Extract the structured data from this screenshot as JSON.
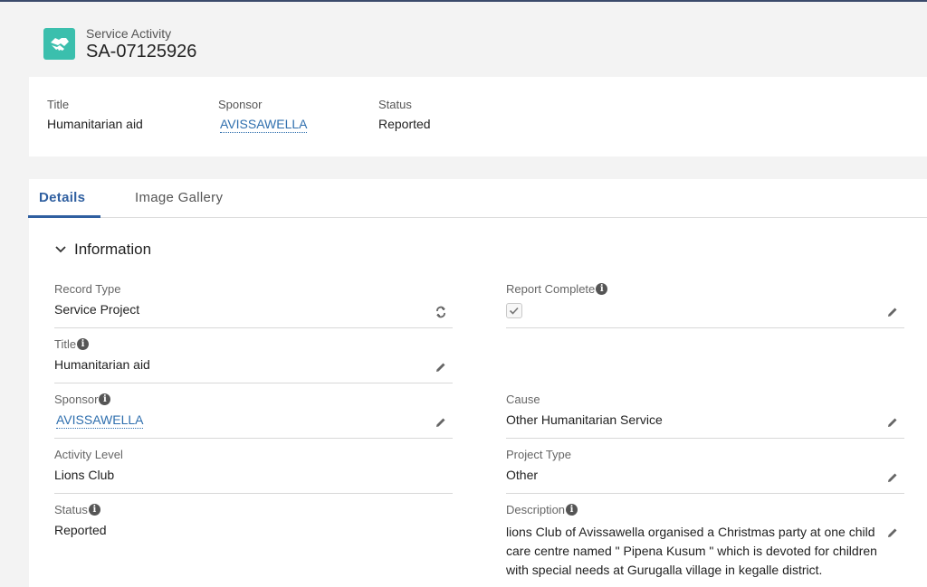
{
  "header": {
    "object_type": "Service Activity",
    "record_name": "SA-07125926",
    "icon": "handshake-icon",
    "icon_color": "#3bbfad"
  },
  "highlights": [
    {
      "label": "Title",
      "value": "Humanitarian aid",
      "is_link": false
    },
    {
      "label": "Sponsor",
      "value": "AVISSAWELLA",
      "is_link": true
    },
    {
      "label": "Status",
      "value": "Reported",
      "is_link": false
    }
  ],
  "tabs": [
    {
      "label": "Details",
      "active": true
    },
    {
      "label": "Image Gallery",
      "active": false
    }
  ],
  "section": {
    "title": "Information"
  },
  "fields": {
    "record_type": {
      "label": "Record Type",
      "value": "Service Project",
      "action_icon": "change-record-type-icon"
    },
    "title": {
      "label": "Title",
      "value": "Humanitarian aid"
    },
    "sponsor": {
      "label": "Sponsor",
      "value": "AVISSAWELLA"
    },
    "activity_level": {
      "label": "Activity Level",
      "value": "Lions Club"
    },
    "status": {
      "label": "Status",
      "value": "Reported"
    },
    "report_complete": {
      "label": "Report Complete",
      "checked": true
    },
    "cause": {
      "label": "Cause",
      "value": "Other Humanitarian Service"
    },
    "project_type": {
      "label": "Project Type",
      "value": "Other"
    },
    "description": {
      "label": "Description",
      "value": "lions Club of Avissawella organised a Christmas party at one child care centre named \" Pipena Kusum \" which is devoted for children with special needs at Gurugalla village in kegalle district."
    }
  },
  "colors": {
    "link": "#2f6fae",
    "active_tab": "#2f5fa0"
  }
}
